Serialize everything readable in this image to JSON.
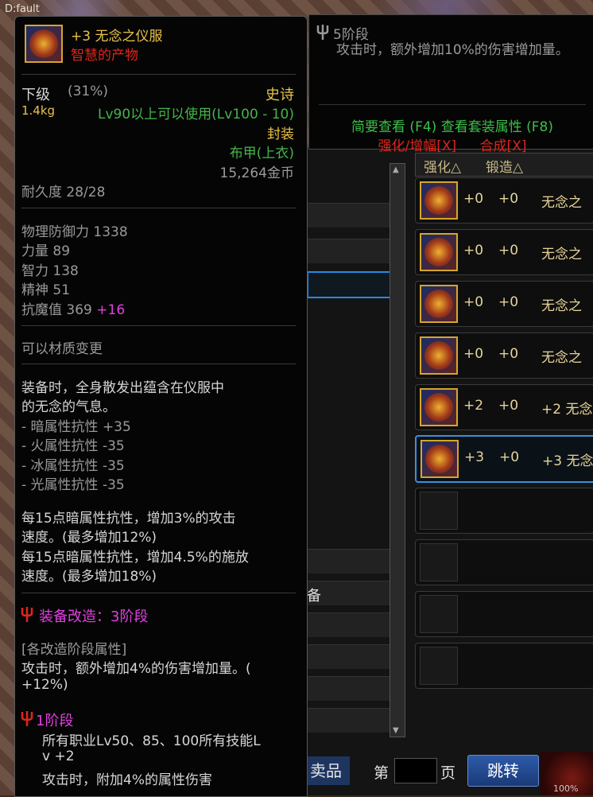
{
  "window": {
    "corner_text": "D:fault"
  },
  "tooltip": {
    "name_line": "+3 无念之仪服",
    "subtitle": "智慧的产物",
    "grade": "下级",
    "grade_pct": "(31%)",
    "rarity": "史诗",
    "weight": "1.4kg",
    "level_req": "Lv90以上可以使用(Lv100 - 10)",
    "sealed": "封装",
    "item_type": "布甲(上衣)",
    "price": "15,264金币",
    "durability": "耐久度 28/28",
    "stats": [
      {
        "label": "物理防御力",
        "value": "1338"
      },
      {
        "label": "力量",
        "value": "89"
      },
      {
        "label": "智力",
        "value": "138"
      },
      {
        "label": "精神",
        "value": "51"
      },
      {
        "label": "抗魔值",
        "value": "369",
        "bonus": "+16"
      }
    ],
    "material_change": "可以材质变更",
    "equip_desc": [
      "装备时，全身散发出蕴含在仪服中",
      "的无念的气息。",
      "- 暗属性抗性 +35",
      "- 火属性抗性 -35",
      "- 冰属性抗性 -35",
      "- 光属性抗性 -35"
    ],
    "bonus_desc": [
      "每15点暗属性抗性，增加3%的攻击",
      "速度。(最多增加12%)",
      "每15点暗属性抗性，增加4.5%的施放",
      "速度。(最多增加18%)"
    ],
    "upgrade_title": "装备改造：3阶段",
    "stage_attr_header": "[各改造阶段属性]",
    "stage_attr_lines": [
      "攻击时，额外增加4%的伤害增加量。(",
      "+12%)"
    ],
    "stage1_title": "1阶段",
    "stage1_lines": [
      "所有职业Lv50、85、100所有技能L",
      "v +2",
      "攻击时，附加4%的属性伤害"
    ]
  },
  "tooltip2": {
    "stage": "5阶段",
    "desc": "攻击时，额外增加10%的伤害增加量。",
    "link_brief": "简要查看 (F4)",
    "link_set": "查看套装属性 (F8)",
    "link_enhance": "强化/增幅[X]",
    "link_craft": "合成[X]"
  },
  "list": {
    "col_enhance": "强化△",
    "col_forge": "锻造△",
    "rows": [
      {
        "enh": "+0",
        "forge": "+0",
        "name": "无念之"
      },
      {
        "enh": "+0",
        "forge": "+0",
        "name": "无念之"
      },
      {
        "enh": "+0",
        "forge": "+0",
        "name": "无念之"
      },
      {
        "enh": "+0",
        "forge": "+0",
        "name": "无念之"
      },
      {
        "enh": "+2",
        "forge": "+0",
        "name": "+2 无念"
      },
      {
        "enh": "+3",
        "forge": "+0",
        "name": "+3 无念"
      }
    ]
  },
  "bottom": {
    "shop_label": "卖品",
    "page_prefix": "第",
    "page_value": "",
    "page_suffix": "页",
    "jump_label": "跳转",
    "gauge_text": "100%"
  },
  "mid": {
    "label_fragment": "备"
  },
  "colors": {
    "accent_gold": "#e8c24a",
    "rarity_epic": "#e8c24a",
    "green": "#45b54a",
    "red": "#e0251c",
    "magenta": "#e040e0",
    "select_blue": "#3a8fe0"
  }
}
